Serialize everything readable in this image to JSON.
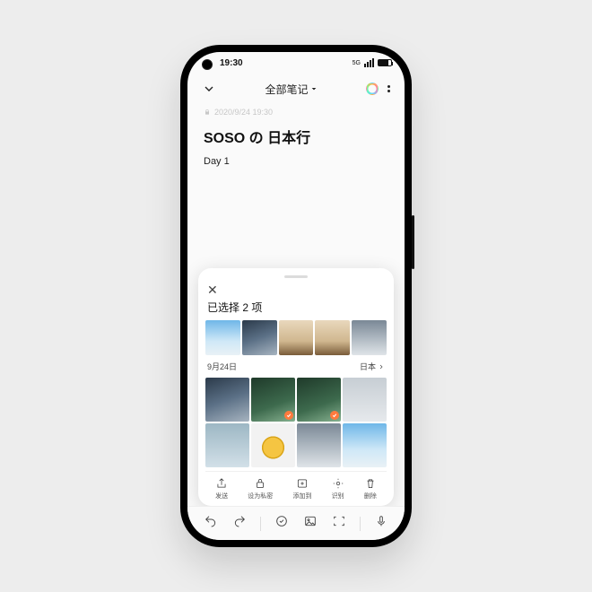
{
  "status": {
    "time": "19:30",
    "net": "5G"
  },
  "header": {
    "title": "全部笔记",
    "has_dropdown": true
  },
  "note": {
    "timestamp": "2020/9/24 19:30",
    "title": "SOSO の 日本行",
    "body": "Day 1"
  },
  "picker": {
    "selected_label": "已选择 2 项",
    "section_date": "9月24日",
    "section_location": "日本",
    "actions": {
      "share": "发送",
      "private": "设为私密",
      "add_to": "添加到",
      "recognize": "识别",
      "delete": "删除"
    }
  }
}
